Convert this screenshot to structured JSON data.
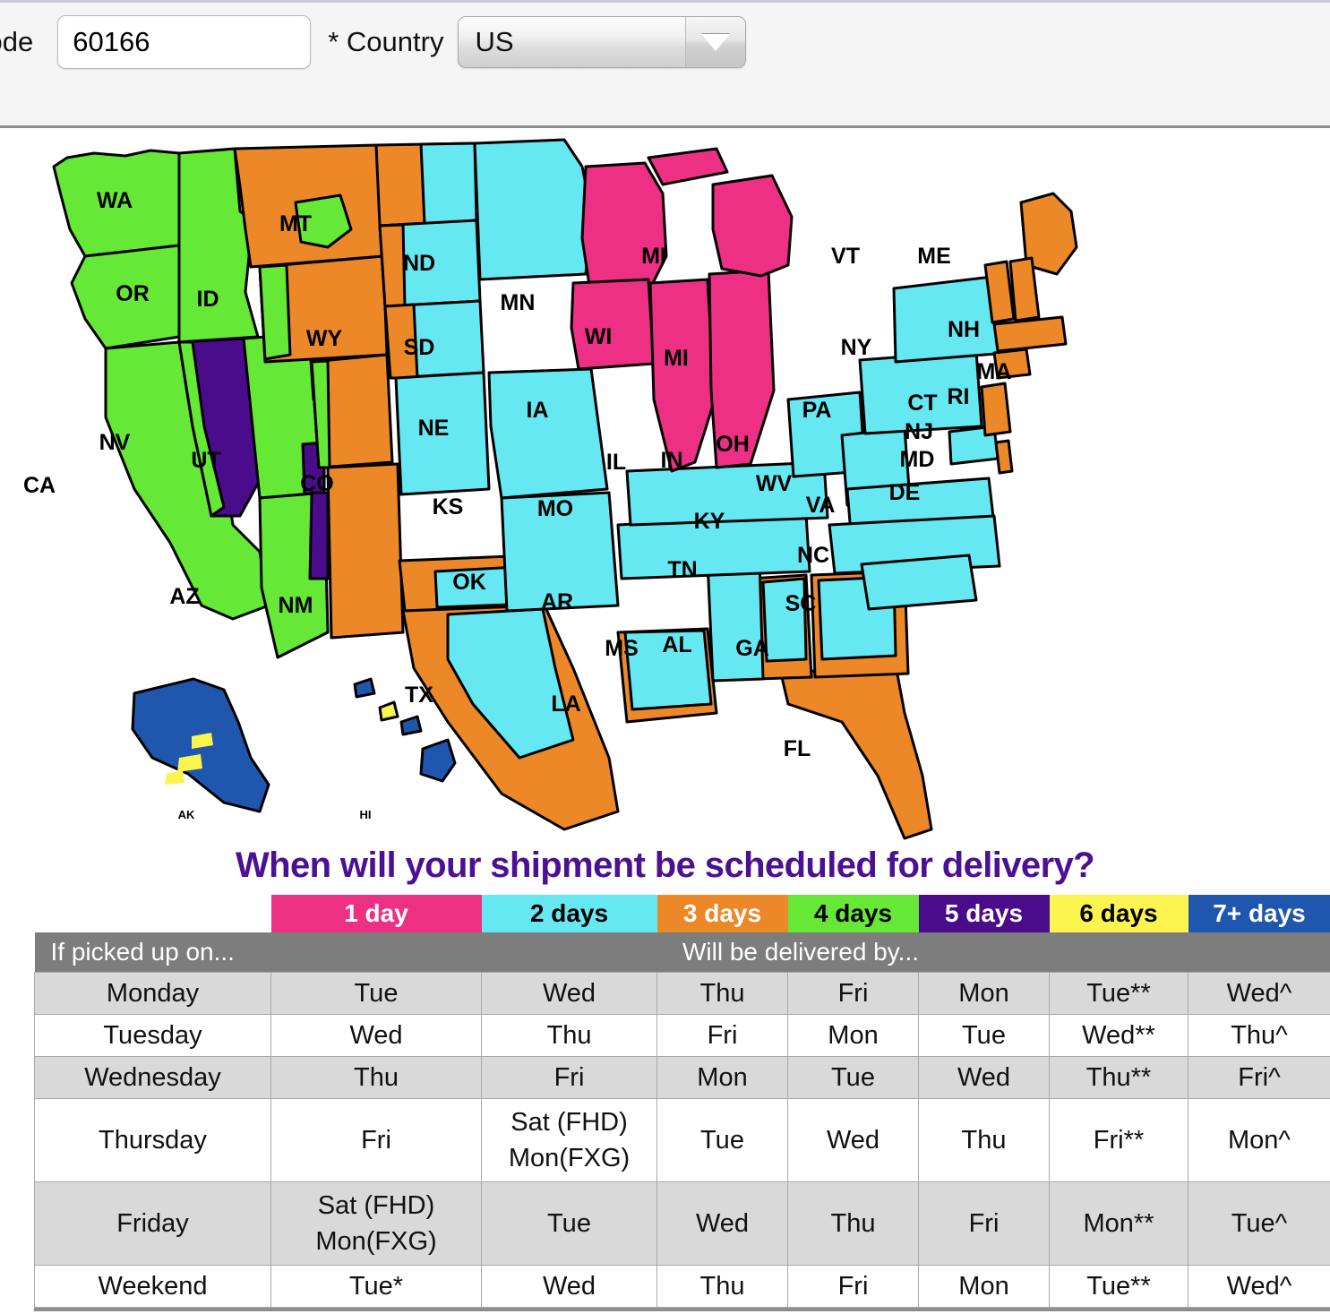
{
  "form": {
    "zip_label": "code",
    "zip_value": "60166",
    "country_label": "* Country",
    "country_value": "US"
  },
  "headline": "When will your shipment be scheduled for delivery?",
  "map": {
    "colors": {
      "day1": "#ED3083",
      "day2": "#66E8F2",
      "day3": "#ED8828",
      "day4": "#66E836",
      "day5": "#4B0C8C",
      "day6": "#FBF44F",
      "day7": "#1F57AE",
      "outline": "#000000"
    },
    "states": [
      {
        "code": "WA",
        "zone": 4
      },
      {
        "code": "OR",
        "zone": 4
      },
      {
        "code": "ID",
        "zone": 4
      },
      {
        "code": "MT",
        "zone": 3
      },
      {
        "code": "WY",
        "zone": 3
      },
      {
        "code": "ND",
        "zone": 3
      },
      {
        "code": "SD",
        "zone": 2
      },
      {
        "code": "MN",
        "zone": 2
      },
      {
        "code": "NE",
        "zone": 2
      },
      {
        "code": "KS",
        "zone": 2
      },
      {
        "code": "CO",
        "zone": 3
      },
      {
        "code": "UT",
        "zone": 4
      },
      {
        "code": "NV",
        "zone": 5
      },
      {
        "code": "CA",
        "zone": 4
      },
      {
        "code": "AZ",
        "zone": 4
      },
      {
        "code": "NM",
        "zone": 3
      },
      {
        "code": "OK",
        "zone": 3
      },
      {
        "code": "TX",
        "zone": 3
      },
      {
        "code": "MO",
        "zone": 2
      },
      {
        "code": "IA",
        "zone": 1
      },
      {
        "code": "WI",
        "zone": 1
      },
      {
        "code": "IL",
        "zone": 1
      },
      {
        "code": "IN",
        "zone": 1
      },
      {
        "code": "MI",
        "zone": 1
      },
      {
        "code": "OH",
        "zone": 2
      },
      {
        "code": "KY",
        "zone": 2
      },
      {
        "code": "TN",
        "zone": 2
      },
      {
        "code": "AR",
        "zone": 2
      },
      {
        "code": "LA",
        "zone": 2
      },
      {
        "code": "MS",
        "zone": 2
      },
      {
        "code": "AL",
        "zone": 3
      },
      {
        "code": "GA",
        "zone": 2
      },
      {
        "code": "FL",
        "zone": 3
      },
      {
        "code": "SC",
        "zone": 2
      },
      {
        "code": "NC",
        "zone": 2
      },
      {
        "code": "VA",
        "zone": 2
      },
      {
        "code": "WV",
        "zone": 2
      },
      {
        "code": "PA",
        "zone": 2
      },
      {
        "code": "NY",
        "zone": 2
      },
      {
        "code": "VT",
        "zone": 3
      },
      {
        "code": "NH",
        "zone": 3
      },
      {
        "code": "ME",
        "zone": 3
      },
      {
        "code": "MA",
        "zone": 3
      },
      {
        "code": "RI",
        "zone": 3
      },
      {
        "code": "CT",
        "zone": 2
      },
      {
        "code": "NJ",
        "zone": 2
      },
      {
        "code": "MD",
        "zone": 2
      },
      {
        "code": "DE",
        "zone": 2
      },
      {
        "code": "AK",
        "zone": 7
      },
      {
        "code": "HI",
        "zone": 7
      }
    ],
    "labels": {
      "WA": "WA",
      "OR": "OR",
      "ID": "ID",
      "MT": "MT",
      "WY": "WY",
      "ND": "ND",
      "SD": "SD",
      "MN": "MN",
      "NE": "NE",
      "KS": "KS",
      "CO": "CO",
      "UT": "UT",
      "NV": "NV",
      "CA": "CA",
      "AZ": "AZ",
      "NM": "NM",
      "OK": "OK",
      "TX": "TX",
      "MO": "MO",
      "IA": "IA",
      "WI": "WI",
      "IL": "IL",
      "IN": "IN",
      "MI": "MI",
      "MI2": "MI",
      "OH": "OH",
      "KY": "KY",
      "TN": "TN",
      "AR": "AR",
      "LA": "LA",
      "MS": "MS",
      "AL": "AL",
      "GA": "GA",
      "FL": "FL",
      "SC": "SC",
      "NC": "NC",
      "VA": "VA",
      "WV": "WV",
      "PA": "PA",
      "NY": "NY",
      "VT": "VT",
      "NH": "NH",
      "ME": "ME",
      "MA": "MA",
      "RI": "RI",
      "CT": "CT",
      "NJ": "NJ",
      "MD": "MD",
      "DE": "DE",
      "AK": "AK",
      "HI": "HI"
    }
  },
  "legend": {
    "items": [
      {
        "label": "1 day",
        "color": "#ED3083",
        "text_color": "#ffffff"
      },
      {
        "label": "2 days",
        "color": "#66E8F2",
        "text_color": "#000000"
      },
      {
        "label": "3 days",
        "color": "#ED8828",
        "text_color": "#ffffff"
      },
      {
        "label": "4 days",
        "color": "#66E836",
        "text_color": "#000000"
      },
      {
        "label": "5 days",
        "color": "#4B0C8C",
        "text_color": "#ffffff"
      },
      {
        "label": "6 days",
        "color": "#FBF44F",
        "text_color": "#000000"
      },
      {
        "label": "7+ days",
        "color": "#1F57AE",
        "text_color": "#ffffff"
      }
    ]
  },
  "table": {
    "header_left": "If picked up on...",
    "header_right": "Will be delivered by...",
    "rows": [
      {
        "day": "Monday",
        "cells": [
          "Tue",
          "Wed",
          "Thu",
          "Fri",
          "Mon",
          "Tue**",
          "Wed^"
        ]
      },
      {
        "day": "Tuesday",
        "cells": [
          "Wed",
          "Thu",
          "Fri",
          "Mon",
          "Tue",
          "Wed**",
          "Thu^"
        ]
      },
      {
        "day": "Wednesday",
        "cells": [
          "Thu",
          "Fri",
          "Mon",
          "Tue",
          "Wed",
          "Thu**",
          "Fri^"
        ]
      },
      {
        "day": "Thursday",
        "cells": [
          "Fri",
          "Sat (FHD)|Mon(FXG)",
          "Tue",
          "Wed",
          "Thu",
          "Fri**",
          "Mon^"
        ]
      },
      {
        "day": "Friday",
        "cells": [
          "Sat (FHD)|Mon(FXG)",
          "Tue",
          "Wed",
          "Thu",
          "Fri",
          "Mon**",
          "Tue^"
        ]
      },
      {
        "day": "Weekend",
        "cells": [
          "Tue*",
          "Wed",
          "Thu",
          "Fri",
          "Mon",
          "Tue**",
          "Wed^"
        ]
      }
    ]
  }
}
